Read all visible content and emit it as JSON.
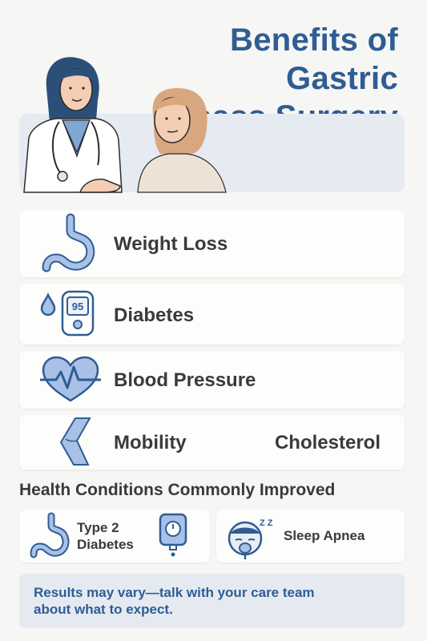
{
  "title_line1": "Benefits of Gastric",
  "title_line2": "Bypass Surgery",
  "benefits": [
    {
      "label": "Weight Loss",
      "icon": "stomach-icon"
    },
    {
      "label": "Diabetes",
      "icon": "glucose-meter-icon",
      "meter_reading": "95"
    },
    {
      "label": "Blood Pressure",
      "icon": "heart-pulse-icon"
    },
    {
      "label": "Mobility",
      "icon": "knee-joint-icon",
      "secondary_label": "Cholesterol"
    }
  ],
  "conditions_title": "Health Conditions Commonly Improved",
  "conditions": [
    {
      "line1": "Type 2",
      "line2": "Diabetes",
      "icon": "stomach-icon"
    },
    {
      "label": "Sleep Apnea",
      "icon": "sleep-mask-icon",
      "zz": "Z Z"
    }
  ],
  "note": "Results may vary—talk with your care team about what to expect.",
  "colors": {
    "accent": "#2f5d93",
    "icon_fill": "#a9c1e6",
    "text": "#3a3a3c",
    "panel": "#e6ebf2"
  }
}
